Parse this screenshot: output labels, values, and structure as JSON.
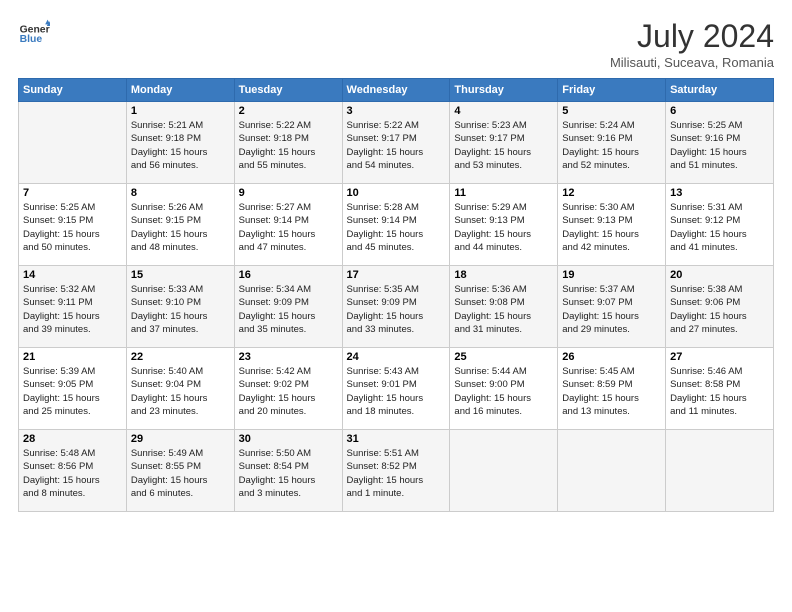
{
  "header": {
    "logo_line1": "General",
    "logo_line2": "Blue",
    "month_year": "July 2024",
    "location": "Milisauti, Suceava, Romania"
  },
  "columns": [
    "Sunday",
    "Monday",
    "Tuesday",
    "Wednesday",
    "Thursday",
    "Friday",
    "Saturday"
  ],
  "weeks": [
    [
      {
        "day": "",
        "info": ""
      },
      {
        "day": "1",
        "info": "Sunrise: 5:21 AM\nSunset: 9:18 PM\nDaylight: 15 hours\nand 56 minutes."
      },
      {
        "day": "2",
        "info": "Sunrise: 5:22 AM\nSunset: 9:18 PM\nDaylight: 15 hours\nand 55 minutes."
      },
      {
        "day": "3",
        "info": "Sunrise: 5:22 AM\nSunset: 9:17 PM\nDaylight: 15 hours\nand 54 minutes."
      },
      {
        "day": "4",
        "info": "Sunrise: 5:23 AM\nSunset: 9:17 PM\nDaylight: 15 hours\nand 53 minutes."
      },
      {
        "day": "5",
        "info": "Sunrise: 5:24 AM\nSunset: 9:16 PM\nDaylight: 15 hours\nand 52 minutes."
      },
      {
        "day": "6",
        "info": "Sunrise: 5:25 AM\nSunset: 9:16 PM\nDaylight: 15 hours\nand 51 minutes."
      }
    ],
    [
      {
        "day": "7",
        "info": "Sunrise: 5:25 AM\nSunset: 9:15 PM\nDaylight: 15 hours\nand 50 minutes."
      },
      {
        "day": "8",
        "info": "Sunrise: 5:26 AM\nSunset: 9:15 PM\nDaylight: 15 hours\nand 48 minutes."
      },
      {
        "day": "9",
        "info": "Sunrise: 5:27 AM\nSunset: 9:14 PM\nDaylight: 15 hours\nand 47 minutes."
      },
      {
        "day": "10",
        "info": "Sunrise: 5:28 AM\nSunset: 9:14 PM\nDaylight: 15 hours\nand 45 minutes."
      },
      {
        "day": "11",
        "info": "Sunrise: 5:29 AM\nSunset: 9:13 PM\nDaylight: 15 hours\nand 44 minutes."
      },
      {
        "day": "12",
        "info": "Sunrise: 5:30 AM\nSunset: 9:13 PM\nDaylight: 15 hours\nand 42 minutes."
      },
      {
        "day": "13",
        "info": "Sunrise: 5:31 AM\nSunset: 9:12 PM\nDaylight: 15 hours\nand 41 minutes."
      }
    ],
    [
      {
        "day": "14",
        "info": "Sunrise: 5:32 AM\nSunset: 9:11 PM\nDaylight: 15 hours\nand 39 minutes."
      },
      {
        "day": "15",
        "info": "Sunrise: 5:33 AM\nSunset: 9:10 PM\nDaylight: 15 hours\nand 37 minutes."
      },
      {
        "day": "16",
        "info": "Sunrise: 5:34 AM\nSunset: 9:09 PM\nDaylight: 15 hours\nand 35 minutes."
      },
      {
        "day": "17",
        "info": "Sunrise: 5:35 AM\nSunset: 9:09 PM\nDaylight: 15 hours\nand 33 minutes."
      },
      {
        "day": "18",
        "info": "Sunrise: 5:36 AM\nSunset: 9:08 PM\nDaylight: 15 hours\nand 31 minutes."
      },
      {
        "day": "19",
        "info": "Sunrise: 5:37 AM\nSunset: 9:07 PM\nDaylight: 15 hours\nand 29 minutes."
      },
      {
        "day": "20",
        "info": "Sunrise: 5:38 AM\nSunset: 9:06 PM\nDaylight: 15 hours\nand 27 minutes."
      }
    ],
    [
      {
        "day": "21",
        "info": "Sunrise: 5:39 AM\nSunset: 9:05 PM\nDaylight: 15 hours\nand 25 minutes."
      },
      {
        "day": "22",
        "info": "Sunrise: 5:40 AM\nSunset: 9:04 PM\nDaylight: 15 hours\nand 23 minutes."
      },
      {
        "day": "23",
        "info": "Sunrise: 5:42 AM\nSunset: 9:02 PM\nDaylight: 15 hours\nand 20 minutes."
      },
      {
        "day": "24",
        "info": "Sunrise: 5:43 AM\nSunset: 9:01 PM\nDaylight: 15 hours\nand 18 minutes."
      },
      {
        "day": "25",
        "info": "Sunrise: 5:44 AM\nSunset: 9:00 PM\nDaylight: 15 hours\nand 16 minutes."
      },
      {
        "day": "26",
        "info": "Sunrise: 5:45 AM\nSunset: 8:59 PM\nDaylight: 15 hours\nand 13 minutes."
      },
      {
        "day": "27",
        "info": "Sunrise: 5:46 AM\nSunset: 8:58 PM\nDaylight: 15 hours\nand 11 minutes."
      }
    ],
    [
      {
        "day": "28",
        "info": "Sunrise: 5:48 AM\nSunset: 8:56 PM\nDaylight: 15 hours\nand 8 minutes."
      },
      {
        "day": "29",
        "info": "Sunrise: 5:49 AM\nSunset: 8:55 PM\nDaylight: 15 hours\nand 6 minutes."
      },
      {
        "day": "30",
        "info": "Sunrise: 5:50 AM\nSunset: 8:54 PM\nDaylight: 15 hours\nand 3 minutes."
      },
      {
        "day": "31",
        "info": "Sunrise: 5:51 AM\nSunset: 8:52 PM\nDaylight: 15 hours\nand 1 minute."
      },
      {
        "day": "",
        "info": ""
      },
      {
        "day": "",
        "info": ""
      },
      {
        "day": "",
        "info": ""
      }
    ]
  ]
}
